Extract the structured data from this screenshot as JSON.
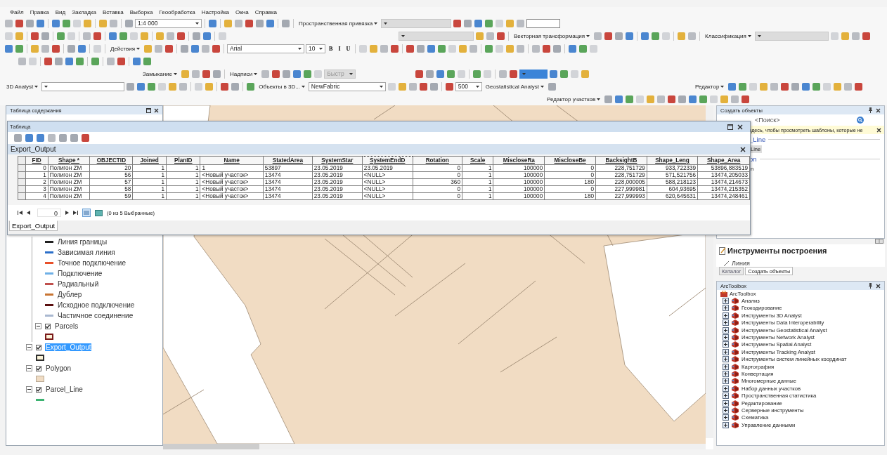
{
  "menu_bar": [
    "Файл",
    "Правка",
    "Вид",
    "Закладка",
    "Вставка",
    "Выборка",
    "Геообработка",
    "Настройка",
    "Окна",
    "Справка"
  ],
  "toolbars": [
    {
      "items": [
        {
          "kind": "combo",
          "value": "1:4 000",
          "disabled": false,
          "selected": false
        },
        {
          "kind": "menu",
          "label": "Пространственная привязка"
        },
        {
          "kind": "combo",
          "disabled": true,
          "selected": false
        },
        {
          "kind": "field"
        }
      ]
    },
    {
      "items": [
        {
          "kind": "combo",
          "disabled": true,
          "selected": false
        },
        {
          "kind": "menu",
          "label": "Векторная трансформация"
        },
        {
          "kind": "menu",
          "label": "Классификация"
        },
        {
          "kind": "combo",
          "disabled": true,
          "selected": false
        }
      ]
    },
    {
      "items": [
        {
          "kind": "menu",
          "label": "Действия"
        },
        {
          "kind": "combo",
          "value": "Arial",
          "disabled": false,
          "selected": false
        },
        {
          "kind": "combo",
          "value": "10",
          "disabled": false,
          "selected": false
        },
        {
          "kind": "text-button",
          "label": "B"
        },
        {
          "kind": "text-button",
          "label": "I"
        },
        {
          "kind": "text-button",
          "label": "U"
        }
      ]
    },
    {
      "items": [
        {
          "kind": "menu",
          "label": "Замыкание"
        },
        {
          "kind": "menu",
          "label": "Надписи"
        },
        {
          "kind": "combo",
          "value": "Быстр",
          "disabled": true,
          "selected": false
        },
        {
          "kind": "combo",
          "disabled": false,
          "selected": true
        }
      ]
    },
    {
      "items": [
        {
          "kind": "menu",
          "label": "3D Analyst"
        },
        {
          "kind": "combo",
          "disabled": false,
          "selected": false
        },
        {
          "kind": "menu",
          "label": "Объекты в 3D..."
        },
        {
          "kind": "combo",
          "value": "NewFabric",
          "disabled": false,
          "selected": false
        },
        {
          "kind": "spinner",
          "value": "500"
        },
        {
          "kind": "menu",
          "label": "Geostatistical Analyst"
        },
        {
          "kind": "menu",
          "label": "Редактор"
        }
      ]
    },
    {
      "items": [
        {
          "kind": "menu",
          "label": "Редактор участков"
        }
      ]
    }
  ],
  "toc": {
    "title": "Таблица содержания",
    "items": [
      {
        "kind": "group",
        "children": [
          {
            "kind": "line",
            "label": "Линия границы",
            "color": "#202020"
          },
          {
            "kind": "line",
            "label": "Зависимая линия",
            "color": "#2b6fc9"
          },
          {
            "kind": "line",
            "label": "Точное подключение",
            "color": "#e8502a"
          },
          {
            "kind": "line",
            "label": "Подключение",
            "color": "#6fb0e6"
          },
          {
            "kind": "line",
            "label": "Радиальный",
            "color": "#c0504d"
          },
          {
            "kind": "line",
            "label": "Дублер",
            "color": "#c87533"
          },
          {
            "kind": "line",
            "label": "Исходное подключение",
            "color": "#5a0f0f"
          },
          {
            "kind": "line",
            "label": "Частичное соединение",
            "color": "#a9b8d0"
          },
          {
            "kind": "layer",
            "label": "Parcels",
            "checked": true,
            "selected": false,
            "expanded": true,
            "children": [
              {
                "kind": "polygon-outline",
                "color": "#7a1a1a"
              }
            ]
          }
        ]
      },
      {
        "kind": "layer",
        "label": "Export_Output",
        "checked": true,
        "selected": true,
        "expanded": true,
        "children": [
          {
            "kind": "polygon-outline",
            "color": "#303030"
          }
        ]
      },
      {
        "kind": "layer",
        "label": "Polygon",
        "checked": true,
        "selected": false,
        "expanded": true,
        "children": [
          {
            "kind": "polygon-fill",
            "color": "#f0dcc4"
          }
        ]
      },
      {
        "kind": "layer",
        "label": "Parcel_Line",
        "checked": true,
        "selected": false,
        "expanded": true,
        "children": [
          {
            "kind": "line",
            "color": "#3cb371"
          }
        ]
      }
    ]
  },
  "table_window": {
    "title": "Таблица",
    "table_name": "Export_Output",
    "columns": [
      {
        "label": "FID",
        "kind": "number",
        "selected": false
      },
      {
        "label": "Shape *",
        "kind": "text",
        "selected": false
      },
      {
        "label": "OBJECTID",
        "kind": "number",
        "selected": false
      },
      {
        "label": "Joined",
        "kind": "number",
        "selected": false
      },
      {
        "label": "PlanID",
        "kind": "number",
        "selected": false
      },
      {
        "label": "Name",
        "kind": "text",
        "selected": false
      },
      {
        "label": "StatedArea",
        "kind": "text",
        "selected": false
      },
      {
        "label": "SystemStar",
        "kind": "text",
        "selected": false
      },
      {
        "label": "SystemEndD",
        "kind": "text",
        "selected": true
      },
      {
        "label": "Rotation",
        "kind": "number",
        "selected": false
      },
      {
        "label": "Scale",
        "kind": "number",
        "selected": false
      },
      {
        "label": "MiscloseRa",
        "kind": "number",
        "selected": false
      },
      {
        "label": "MiscloseBe",
        "kind": "number",
        "selected": false
      },
      {
        "label": "BacksightB",
        "kind": "number",
        "selected": false
      },
      {
        "label": "Shape_Leng",
        "kind": "number",
        "selected": false
      },
      {
        "label": "Shape_Area",
        "kind": "number",
        "selected": false
      }
    ],
    "rows": [
      {
        "selected": false,
        "cells": [
          "0",
          "Полигон ZM",
          "20",
          "1",
          "1",
          "1",
          "53897",
          "23.05.2019",
          "23.05.2019",
          "0",
          "1",
          "100000",
          "0",
          "228,751729",
          "933,722339",
          "53896,883519"
        ]
      },
      {
        "selected": false,
        "cells": [
          "1",
          "Полигон ZM",
          "56",
          "1",
          "1",
          "<Новый участок>",
          "13474",
          "23.05.2019",
          "<NULL>",
          "0",
          "1",
          "100000",
          "0",
          "228,751729",
          "571,521756",
          "13474,205033"
        ]
      },
      {
        "selected": false,
        "cells": [
          "2",
          "Полигон ZM",
          "57",
          "1",
          "1",
          "<Новый участок>",
          "13474",
          "23.05.2019",
          "<NULL>",
          "360",
          "1",
          "100000",
          "180",
          "228,000005",
          "588,218123",
          "13474,214673"
        ]
      },
      {
        "selected": false,
        "cells": [
          "3",
          "Полигон ZM",
          "58",
          "1",
          "1",
          "<Новый участок>",
          "13474",
          "23.05.2019",
          "<NULL>",
          "0",
          "1",
          "100000",
          "0",
          "227,999981",
          "604,93695",
          "13474,215352"
        ]
      },
      {
        "selected": false,
        "cells": [
          "4",
          "Полигон ZM",
          "59",
          "1",
          "1",
          "<Новый участок>",
          "13474",
          "23.05.2019",
          "<NULL>",
          "0",
          "1",
          "100000",
          "180",
          "227,999993",
          "620,645631",
          "13474,248461"
        ]
      }
    ],
    "record": "0",
    "selection_status": "(0 из 5 Выбранные)",
    "tabs": [
      {
        "label": "Export_Output",
        "selected": true
      }
    ]
  },
  "create_features": {
    "title": "Создать объекты",
    "search": {
      "placeholder": "<Поиск>"
    },
    "info": "здесь, чтобы просмотреть шаблоны, которые не",
    "templates": [
      {
        "kind": "group",
        "label": "_Line"
      },
      {
        "kind": "item",
        "label": "Line",
        "selected": true
      },
      {
        "kind": "group",
        "label": "on"
      },
      {
        "kind": "item",
        "label": "n",
        "selected": false
      }
    ]
  },
  "construction_tools": {
    "title": "Инструменты построения",
    "items": [
      "Линия"
    ]
  },
  "dock_tabs": [
    {
      "label": "Каталог",
      "selected": false
    },
    {
      "label": "Создать объекты",
      "selected": true
    }
  ],
  "arctoolbox": {
    "title": "ArcToolbox",
    "root": {
      "label": "ArcToolbox",
      "children": [
        {
          "label": "Анализ",
          "expanded": false
        },
        {
          "label": "Геокодирование",
          "expanded": false
        },
        {
          "label": "Инструменты 3D Analyst",
          "expanded": false
        },
        {
          "label": "Инструменты Data Interoperability",
          "expanded": false
        },
        {
          "label": "Инструменты Geostatistical Analyst",
          "expanded": false
        },
        {
          "label": "Инструменты Network Analyst",
          "expanded": false
        },
        {
          "label": "Инструменты Spatial Analyst",
          "expanded": false
        },
        {
          "label": "Инструменты Tracking Analyst",
          "expanded": false
        },
        {
          "label": "Инструменты систем линейных координат",
          "expanded": false
        },
        {
          "label": "Картография",
          "expanded": false
        },
        {
          "label": "Конвертация",
          "expanded": false
        },
        {
          "label": "Многомерные данные",
          "expanded": false
        },
        {
          "label": "Набор данных участков",
          "expanded": false
        },
        {
          "label": "Пространственная статистика",
          "expanded": false
        },
        {
          "label": "Редактирование",
          "expanded": false
        },
        {
          "label": "Серверные инструменты",
          "expanded": false
        },
        {
          "label": "Схематика",
          "expanded": false
        },
        {
          "label": "Управление данными",
          "expanded": false
        }
      ]
    }
  }
}
